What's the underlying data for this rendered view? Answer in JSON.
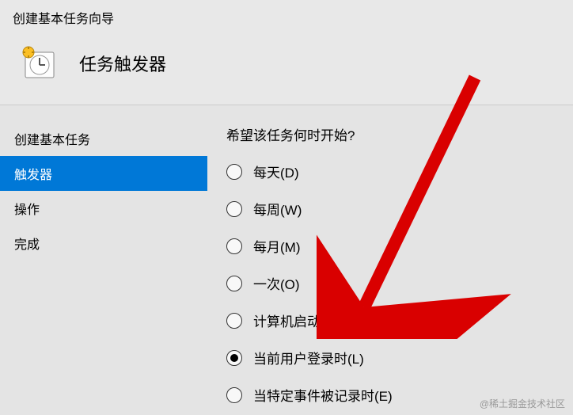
{
  "dialog": {
    "title": "创建基本任务向导"
  },
  "header": {
    "title": "任务触发器"
  },
  "sidebar": {
    "items": [
      {
        "label": "创建基本任务",
        "selected": false
      },
      {
        "label": "触发器",
        "selected": true
      },
      {
        "label": "操作",
        "selected": false
      },
      {
        "label": "完成",
        "selected": false
      }
    ]
  },
  "main": {
    "heading": "希望该任务何时开始?",
    "options": [
      {
        "label": "每天(D)",
        "checked": false
      },
      {
        "label": "每周(W)",
        "checked": false
      },
      {
        "label": "每月(M)",
        "checked": false
      },
      {
        "label": "一次(O)",
        "checked": false
      },
      {
        "label": "计算机启动时",
        "checked": false
      },
      {
        "label": "当前用户登录时(L)",
        "checked": true
      },
      {
        "label": "当特定事件被记录时(E)",
        "checked": false
      }
    ]
  },
  "watermark": "@稀土掘金技术社区",
  "colors": {
    "accent": "#0078d7",
    "arrow": "#d90000"
  }
}
